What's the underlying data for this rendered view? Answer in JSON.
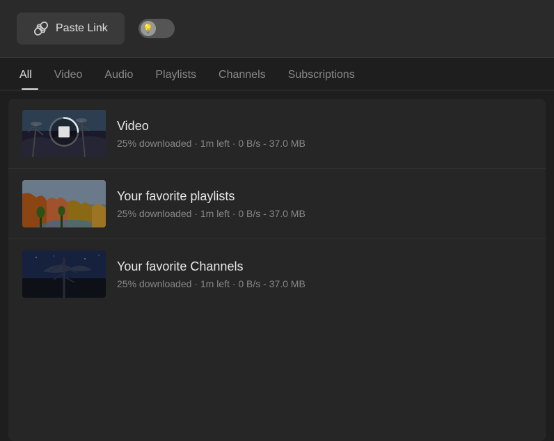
{
  "header": {
    "paste_link_label": "Paste Link",
    "toggle_aria": "Theme toggle"
  },
  "tabs": [
    {
      "id": "all",
      "label": "All",
      "active": true
    },
    {
      "id": "video",
      "label": "Video",
      "active": false
    },
    {
      "id": "audio",
      "label": "Audio",
      "active": false
    },
    {
      "id": "playlists",
      "label": "Playlists",
      "active": false
    },
    {
      "id": "channels",
      "label": "Channels",
      "active": false
    },
    {
      "id": "subscriptions",
      "label": "Subscriptions",
      "active": false
    }
  ],
  "downloads": [
    {
      "id": "item-1",
      "title": "Video",
      "status": "25% downloaded · 1m left · 0 B/s - 37.0 MB",
      "thumbnail_type": "winter",
      "has_stop": true
    },
    {
      "id": "item-2",
      "title": "Your favorite playlists",
      "status": "25% downloaded · 1m left · 0 B/s - 37.0 MB",
      "thumbnail_type": "canyon",
      "has_stop": false
    },
    {
      "id": "item-3",
      "title": "Your favorite Channels",
      "status": "25% downloaded · 1m left · 0 B/s - 37.0 MB",
      "thumbnail_type": "dark",
      "has_stop": false
    }
  ],
  "icons": {
    "paste_link": "⊙",
    "bulb": "💡"
  },
  "colors": {
    "active_tab_underline": "#e0e0e0",
    "background": "#1e1e1e",
    "surface": "#262626",
    "header_bg": "#2a2a2a"
  }
}
